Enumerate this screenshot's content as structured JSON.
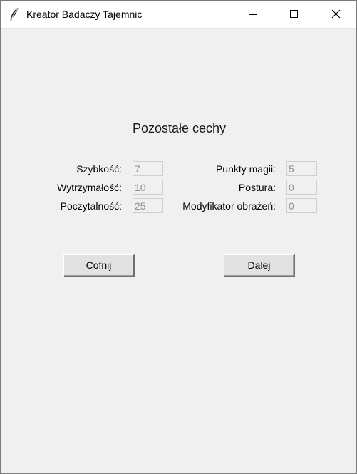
{
  "window": {
    "title": "Kreator Badaczy Tajemnic",
    "icon": "feather-icon",
    "controls": [
      "minimize-icon",
      "maximize-icon",
      "close-icon"
    ]
  },
  "main": {
    "heading": "Pozostałe cechy",
    "left_fields": [
      {
        "label": "Szybkość:",
        "value": "7"
      },
      {
        "label": "Wytrzymałość:",
        "value": "10"
      },
      {
        "label": "Poczytalność:",
        "value": "25"
      }
    ],
    "right_fields": [
      {
        "label": "Punkty magii:",
        "value": "5"
      },
      {
        "label": "Postura:",
        "value": "0"
      },
      {
        "label": "Modyfikator obrażeń:",
        "value": "0"
      }
    ]
  },
  "buttons": {
    "back_label": "Cofnij",
    "next_label": "Dalej"
  },
  "colors": {
    "window_bg": "#f0f0f0",
    "titlebar_bg": "#ffffff",
    "disabled_text": "#8f8f8f"
  }
}
